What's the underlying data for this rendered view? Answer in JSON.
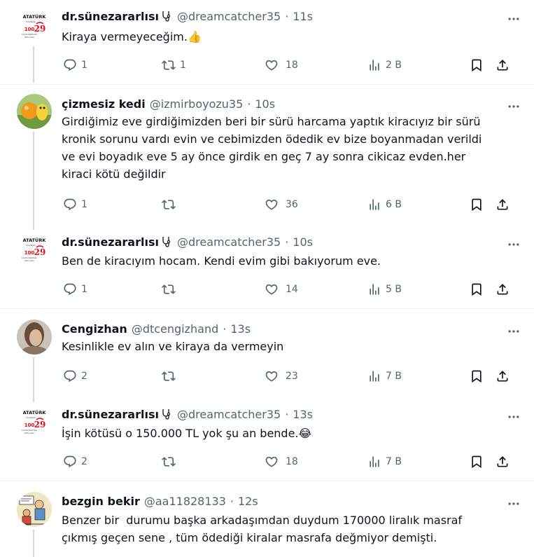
{
  "tweets": [
    {
      "name": "dr.sünezararlısı",
      "verified_emoji": "🩺",
      "handle": "@dreamcatcher35",
      "time": "11s",
      "text_lines": [
        "Kiraya vermeyeceğim."
      ],
      "text_emoji": "👍",
      "replies": "1",
      "retweets": "1",
      "likes": "18",
      "views": "2 B",
      "avatar": "ataturk-logo"
    },
    {
      "name": "çizmesiz kedi",
      "handle": "@izmirboyozu35",
      "time": "10s",
      "text_lines": [
        "Girdiğimiz eve girdiğimizden beri bir sürü harcama yaptık kiracıyız bir sürü",
        "kronik sorunu vardı evin ve cebimizden ödedik ev bize boyanmadan verildi",
        "ve evi boyadık eve 5 ay önce girdik en geç 7 ay sonra cikicaz evden.her",
        "kiraci kötü değildir"
      ],
      "replies": "1",
      "retweets": "",
      "likes": "36",
      "views": "6 B",
      "avatar": "cartoon-cat"
    },
    {
      "name": "dr.sünezararlısı",
      "verified_emoji": "🩺",
      "handle": "@dreamcatcher35",
      "time": "10s",
      "text_lines": [
        "Ben de kiracıyım hocam. Kendi evim gibi bakıyorum eve."
      ],
      "replies": "1",
      "retweets": "",
      "likes": "14",
      "views": "5 B",
      "avatar": "ataturk-logo"
    },
    {
      "name": "Cengizhan",
      "handle": "@dtcengizhand",
      "time": "13s",
      "text_lines": [
        "Kesinlikle ev alın ve kiraya da vermeyin"
      ],
      "replies": "2",
      "retweets": "",
      "likes": "23",
      "views": "7 B",
      "avatar": "portrait"
    },
    {
      "name": "dr.sünezararlısı",
      "verified_emoji": "🩺",
      "handle": "@dreamcatcher35",
      "time": "13s",
      "text_lines": [
        "İşin kötüsü o 150.000 TL yok şu an bende."
      ],
      "text_emoji": "😂",
      "replies": "2",
      "retweets": "",
      "likes": "18",
      "views": "7 B",
      "avatar": "ataturk-logo"
    },
    {
      "name": "bezgin bekir",
      "handle": "@aa11828133",
      "time": "12s",
      "text_lines": [
        "Benzer bir  durumu başka arkadaşımdan duydum 170000 liralık masraf",
        "çıkmış geçen sene , tüm ödediği kiralar masrafa değmiyor demişti."
      ],
      "avatar": "comic-drawing"
    }
  ],
  "logo_text": {
    "title": "ATATÜRK",
    "line1": "İzindeyiz",
    "number": "100",
    "line2": "Cumhuriyetimizin",
    "line3": "Kutlu olsun"
  },
  "colors": {
    "text": "#0f1419",
    "secondary": "#536471",
    "divider": "#eff3f4",
    "thread_line": "#cfd9de",
    "logo_red": "#e30a17"
  }
}
